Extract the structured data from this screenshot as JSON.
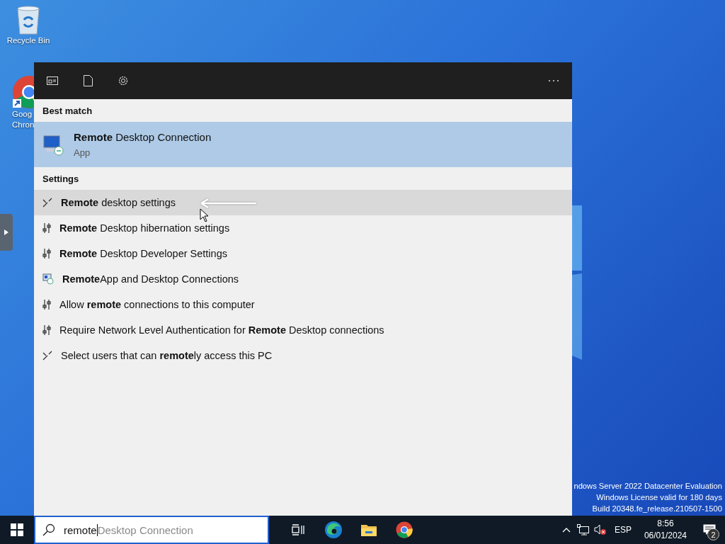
{
  "desktop_icons": [
    {
      "kind": "recycle",
      "lines": [
        "Recycle Bin"
      ]
    },
    {
      "kind": "chrome",
      "lines": [
        "Goog",
        "Chron"
      ]
    }
  ],
  "search_panel": {
    "best_match": {
      "heading": "Best match",
      "title": "**Remote** Desktop Connection",
      "subtitle": "App",
      "selected": true
    },
    "settings": {
      "heading": "Settings",
      "items": [
        {
          "kind": "display",
          "text": "**Remote** desktop settings",
          "selected": true
        },
        {
          "kind": "sliders",
          "text": "**Remote** Desktop hibernation settings",
          "selected": false
        },
        {
          "kind": "sliders",
          "text": "**Remote** Desktop Developer Settings",
          "selected": false
        },
        {
          "kind": "remoteapp",
          "text": "**Remote**App and Desktop Connections",
          "selected": false
        },
        {
          "kind": "sliders",
          "text": "Allow **remote** connections to this computer",
          "selected": false
        },
        {
          "kind": "sliders",
          "text": "Require Network Level Authentication for **Remote** Desktop connections",
          "selected": false
        },
        {
          "kind": "display",
          "text": "Select users that can **remote**ly access this PC",
          "selected": false
        }
      ]
    }
  },
  "watermark_lines": [
    "ndows Server 2022 Datacenter Evaluation",
    "Windows License valid for 180 days",
    "Build 20348.fe_release.210507-1500"
  ],
  "taskbar": {
    "search": {
      "value": "remote",
      "suggestion": "Desktop Connection"
    },
    "language": "ESP",
    "time": "8:56",
    "date": "06/01/2024",
    "notifications": "2"
  }
}
